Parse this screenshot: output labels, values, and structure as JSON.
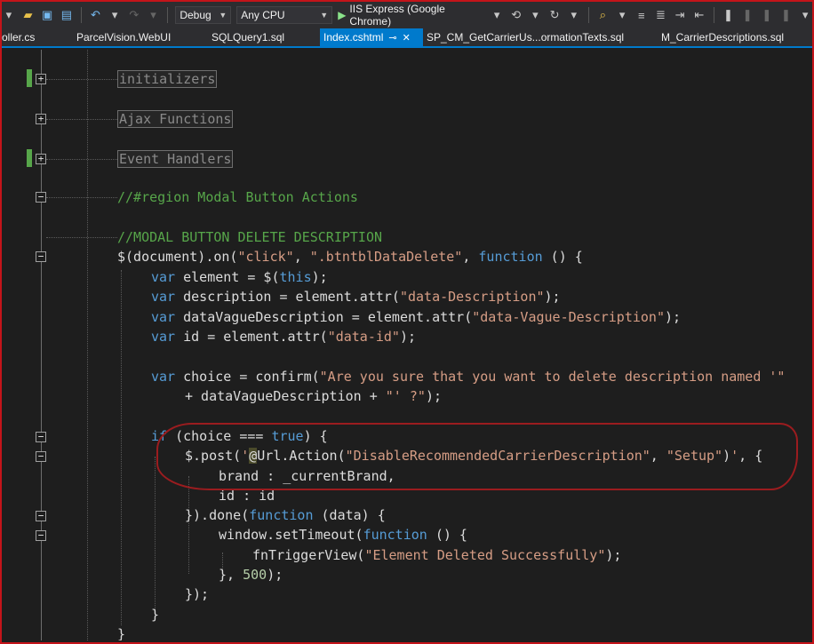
{
  "toolbar": {
    "config": "Debug",
    "platform": "Any CPU",
    "run_target": "IIS Express (Google Chrome)"
  },
  "tabs": [
    {
      "label": "oller.cs"
    },
    {
      "label": "ParcelVision.WebUI"
    },
    {
      "label": "SQLQuery1.sql"
    },
    {
      "label": "Index.cshtml",
      "active": true
    },
    {
      "label": "SP_CM_GetCarrierUs...ormationTexts.sql"
    },
    {
      "label": "M_CarrierDescriptions.sql"
    }
  ],
  "icons": {
    "new": "file-icon",
    "open": "folder-icon",
    "save": "save-icon",
    "save_all": "save-all-icon",
    "undo": "undo-icon",
    "redo": "redo-icon",
    "run": "play-icon",
    "refresh": "refresh-icon",
    "browser_link": "browser-link-icon",
    "find": "find-in-files-icon",
    "bookmark": "bookmark-icon"
  },
  "code": {
    "r1": "initializers",
    "r2": "Ajax Functions",
    "r3": "Event Handlers",
    "c1": "//#region Modal Button Actions",
    "c2": "//MODAL BUTTON DELETE DESCRIPTION",
    "l1": {
      "a": "$(document).on(",
      "b": "\"click\"",
      "c": ", ",
      "d": "\".btntblDataDelete\"",
      "e": ", ",
      "f": "function",
      "g": " () {"
    },
    "l2": {
      "a": "var",
      "b": " element = $(",
      "c": "this",
      "d": ");"
    },
    "l3": {
      "a": "var",
      "b": " description = element.attr(",
      "c": "\"data-Description\"",
      "d": ");"
    },
    "l4": {
      "a": "var",
      "b": " dataVagueDescription = element.attr(",
      "c": "\"data-Vague-Description\"",
      "d": ");"
    },
    "l5": {
      "a": "var",
      "b": " id = element.attr(",
      "c": "\"data-id\"",
      "d": ");"
    },
    "l6": {
      "a": "var",
      "b": " choice = confirm(",
      "c": "\"Are you sure that you want to delete description named '\""
    },
    "l7": {
      "a": "+ dataVagueDescription + ",
      "b": "\"' ?\"",
      "c": ");"
    },
    "l8": {
      "a": "if",
      "b": " (choice === ",
      "c": "true",
      "d": ") {"
    },
    "l9": {
      "a": "$.post(",
      "b": "'",
      "c": "@",
      "d": "Url.Action(",
      "e": "\"DisableRecommendedCarrierDescription\"",
      "f": ", ",
      "g": "\"Setup\"",
      "h": ")",
      "i": "'",
      "j": ", {"
    },
    "l10": "brand : _currentBrand,",
    "l11": "id : id",
    "l12": {
      "a": "}).done(",
      "b": "function",
      "c": " (data) {"
    },
    "l13": {
      "a": "window.setTimeout(",
      "b": "function",
      "c": " () {"
    },
    "l14": {
      "a": "fnTriggerView(",
      "b": "\"Element Deleted Successfully\"",
      "c": ");"
    },
    "l15": {
      "a": "}, ",
      "b": "500",
      "c": ");"
    },
    "l16": "});",
    "l17": "}",
    "l18": "}"
  }
}
